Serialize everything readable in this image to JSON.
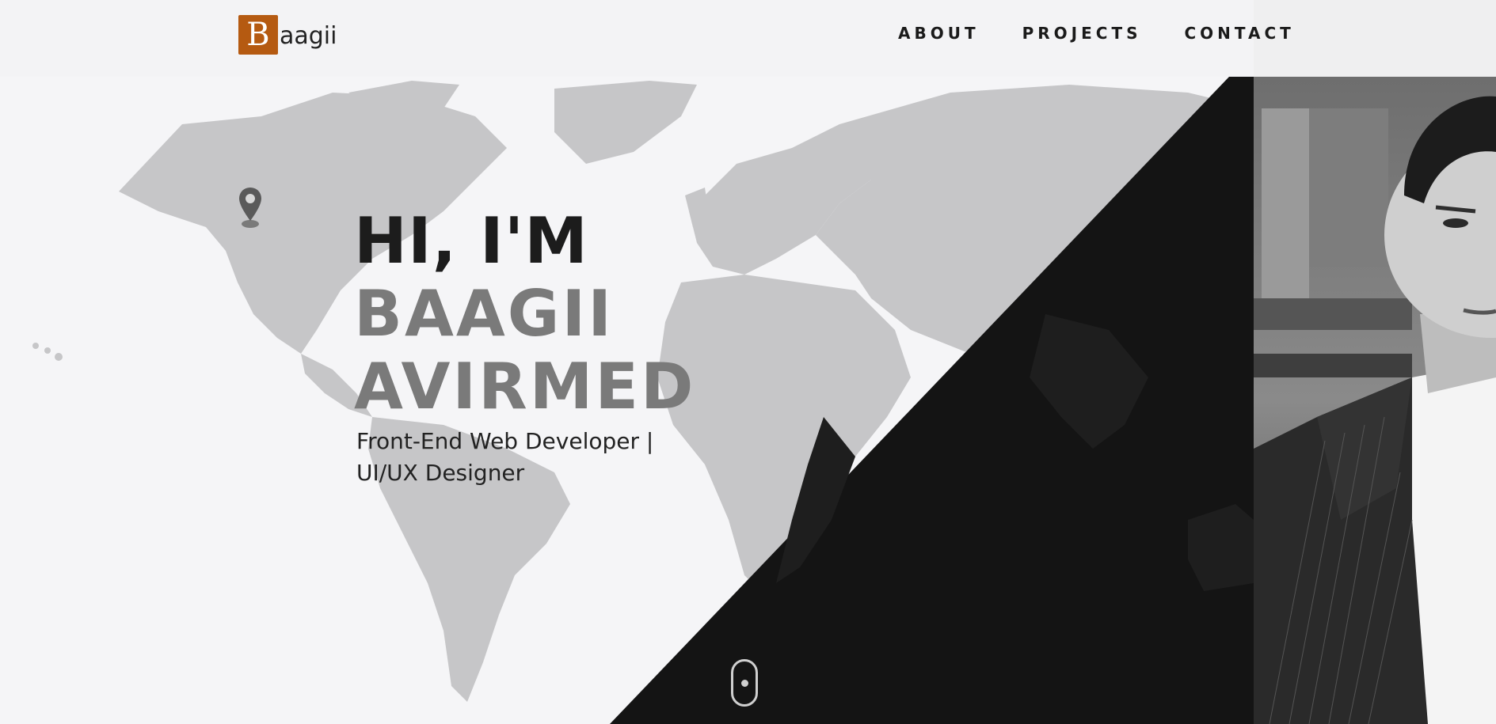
{
  "logo": {
    "letter": "B",
    "text": "aagii",
    "accent": "#b55a11"
  },
  "nav": {
    "items": [
      "ABOUT",
      "PROJECTS",
      "CONTACT"
    ]
  },
  "hero": {
    "greeting": "HI, I'M",
    "first_name": "BAAGII",
    "last_name": "AVIRMED",
    "subtitle_line1": "Front-End Web Developer |",
    "subtitle_line2": "UI/UX Designer"
  },
  "icons": {
    "pin": "map-pin-icon",
    "scroll": "mouse-scroll-icon"
  },
  "colors": {
    "dark_panel": "#141414",
    "page_bg": "#f5f5f7",
    "map_gray": "#c4c4c6"
  }
}
